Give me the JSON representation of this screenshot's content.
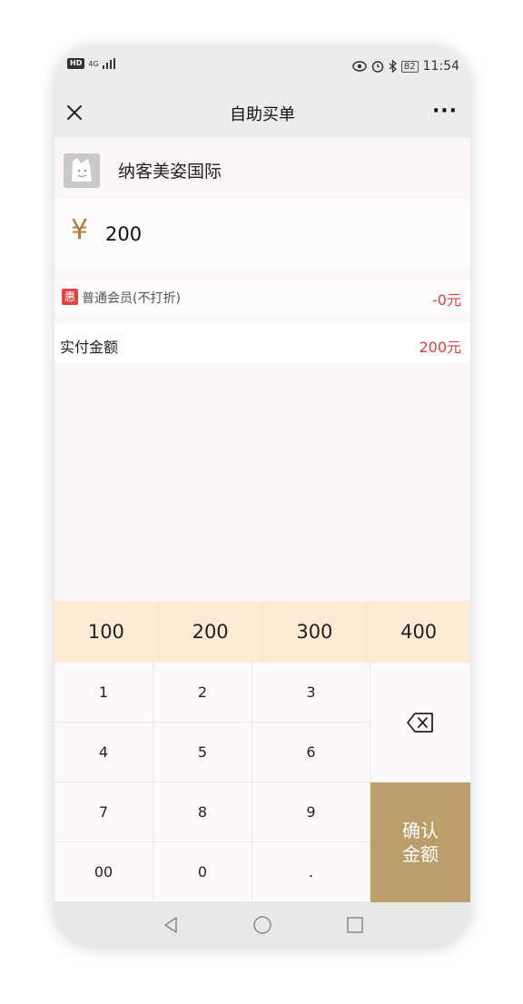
{
  "status_bar": {
    "network": "HD",
    "signal_label": "4G",
    "battery": "82",
    "time": "11:54",
    "icons": [
      "eye-icon",
      "alarm-icon",
      "bluetooth-icon"
    ]
  },
  "nav": {
    "title": "自助买单",
    "close_icon": "close-icon",
    "more_label": "···"
  },
  "shop": {
    "name": "纳客美姿国际"
  },
  "amount": {
    "currency": "¥",
    "value": "200"
  },
  "discount": {
    "badge": "惠",
    "label": "普通会员(不打折)",
    "value": "-0元"
  },
  "paid": {
    "label": "实付金额",
    "value": "200元"
  },
  "quick_amounts": [
    "100",
    "200",
    "300",
    "400"
  ],
  "keypad": {
    "keys": [
      "1",
      "2",
      "3",
      "4",
      "5",
      "6",
      "7",
      "8",
      "9",
      "00",
      "0",
      "."
    ],
    "confirm_line1": "确认",
    "confirm_line2": "金额"
  },
  "colors": {
    "accent_gold": "#bc9d6c",
    "price_red": "#e23b3b",
    "quick_bg": "#fdebd5"
  }
}
